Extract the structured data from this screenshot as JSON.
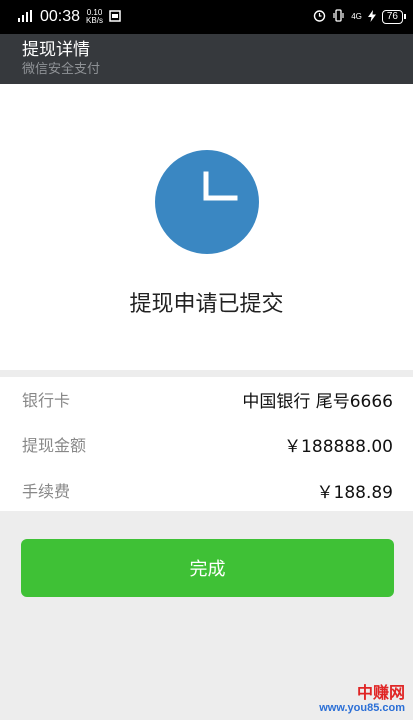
{
  "status_bar": {
    "network": "4G",
    "time": "00:38",
    "speed_value": "0.10",
    "speed_unit": "KB/s",
    "icons": [
      "signal-icon",
      "notification-icon",
      "alarm-icon",
      "vibrate-icon",
      "mobile-data-icon",
      "charging-icon",
      "battery-icon"
    ],
    "right_net": "4G",
    "battery": "76"
  },
  "header": {
    "title": "提现详情",
    "subtitle": "微信安全支付"
  },
  "status": {
    "icon": "clock-icon",
    "message": "提现申请已提交"
  },
  "details": [
    {
      "label": "银行卡",
      "value": "中国银行 尾号6666"
    },
    {
      "label": "提现金额",
      "value": "￥188888.00"
    },
    {
      "label": "手续费",
      "value": "￥188.89"
    }
  ],
  "button": {
    "label": "完成"
  },
  "watermark": {
    "top": "中赚网",
    "bottom": "www.you85.com"
  },
  "colors": {
    "header_bg": "#36393d",
    "clock_blue": "#3a87c2",
    "button_green": "#3fc136"
  }
}
